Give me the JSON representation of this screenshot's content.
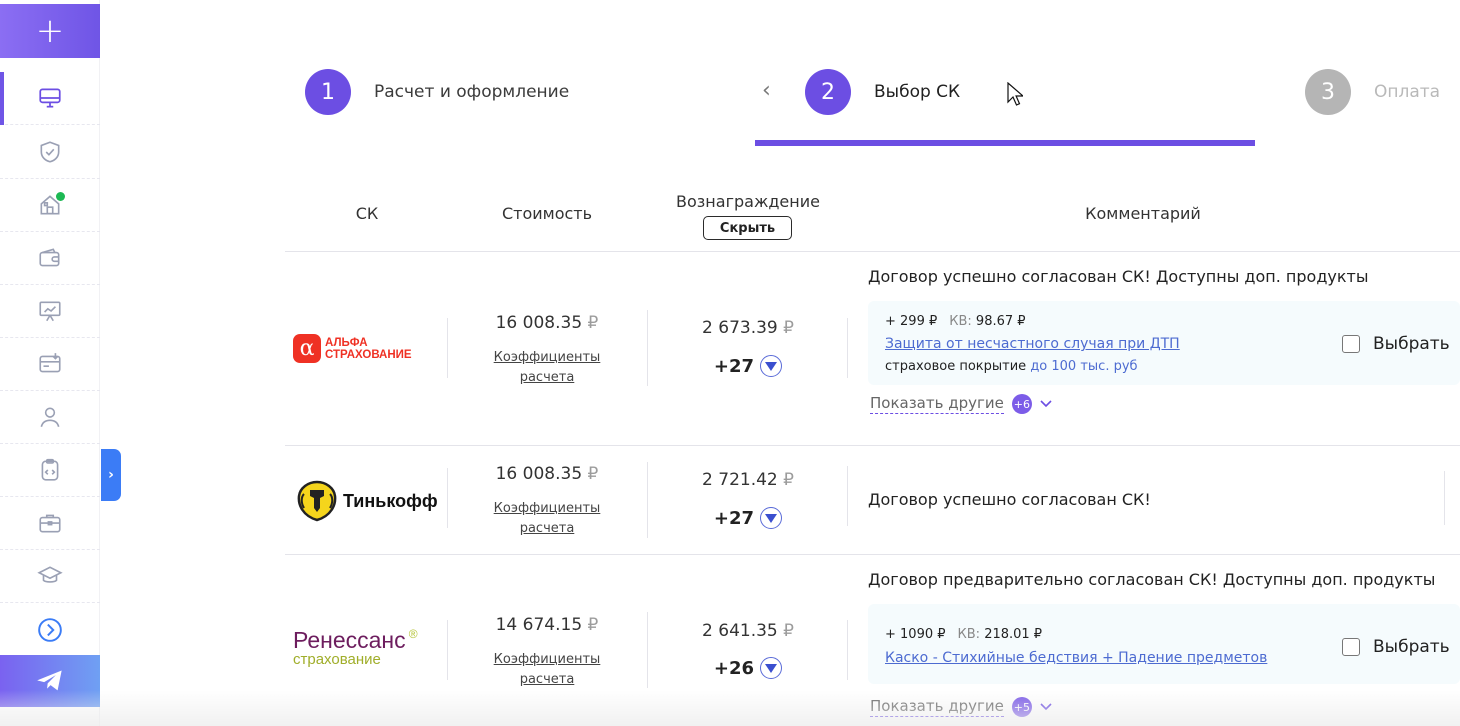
{
  "sidebar": {
    "add_icon": "+",
    "items": [
      {
        "icon": "monitor-icon",
        "active": true
      },
      {
        "icon": "shield-check-icon"
      },
      {
        "icon": "house-icon",
        "notification": true
      },
      {
        "icon": "wallet-icon"
      },
      {
        "icon": "presentation-chart-icon"
      },
      {
        "icon": "invoice-icon"
      },
      {
        "icon": "user-icon"
      },
      {
        "icon": "clipboard-code-icon"
      },
      {
        "icon": "briefcase-icon"
      },
      {
        "icon": "graduation-cap-icon"
      },
      {
        "icon": "arrow-circle-right-icon"
      }
    ],
    "telegram_icon": "telegram-icon",
    "collapse_icon": "›",
    "accent_color": "#6c4ee3"
  },
  "stepper": {
    "prev_icon": "‹",
    "steps": [
      {
        "number": "1",
        "label": "Расчет и оформление",
        "state": "done"
      },
      {
        "number": "2",
        "label": "Выбор СК",
        "state": "active"
      },
      {
        "number": "3",
        "label": "Оплата",
        "state": "disabled"
      }
    ]
  },
  "table": {
    "headers": {
      "company": "СК",
      "price": "Стоимость",
      "reward": "Вознаграждение",
      "hide_button": "Скрыть",
      "comment": "Комментарий"
    },
    "rows": [
      {
        "company": "АльфаСтрахование",
        "logo_lines": [
          "АЛЬФА",
          "СТРАХОВАНИЕ"
        ],
        "price": "16 008.35",
        "currency": "₽",
        "coef_link_line1": "Коэффициенты",
        "coef_link_line2": "расчета",
        "reward": "2 673.39",
        "bonus": "+27",
        "comment": "Договор успешно согласован СК! Доступны доп. продукты",
        "product": {
          "price": "+ 299 ₽",
          "kv_label": "КВ:",
          "kv_value": "98.67 ₽",
          "link": "Защита от несчастного случая при ДТП",
          "coverage_label": "страховое покрытие",
          "coverage_value": "до 100 тыс. руб"
        },
        "choose_label": "Выбрать",
        "show_more": "Показать другие",
        "show_more_count": "+6"
      },
      {
        "company": "Тинькофф",
        "logo_text": "Тинькофф",
        "price": "16 008.35",
        "currency": "₽",
        "coef_link_line1": "Коэффициенты",
        "coef_link_line2": "расчета",
        "reward": "2 721.42",
        "bonus": "+27",
        "comment": "Договор успешно согласован СК!"
      },
      {
        "company": "Ренессанс страхование",
        "logo_lines": [
          "Ренессанс",
          "страхование"
        ],
        "logo_mark": "®",
        "price": "14 674.15",
        "currency": "₽",
        "coef_link_line1": "Коэффициенты",
        "coef_link_line2": "расчета",
        "reward": "2 641.35",
        "bonus": "+26",
        "comment": "Договор предварительно согласован СК! Доступны доп. продукты",
        "product": {
          "price": "+ 1090 ₽",
          "kv_label": "КВ:",
          "kv_value": "218.01 ₽",
          "link": "Каско - Стихийные бедствия + Падение предметов"
        },
        "choose_label": "Выбрать",
        "show_more": "Показать другие",
        "show_more_count": "+5"
      }
    ]
  }
}
